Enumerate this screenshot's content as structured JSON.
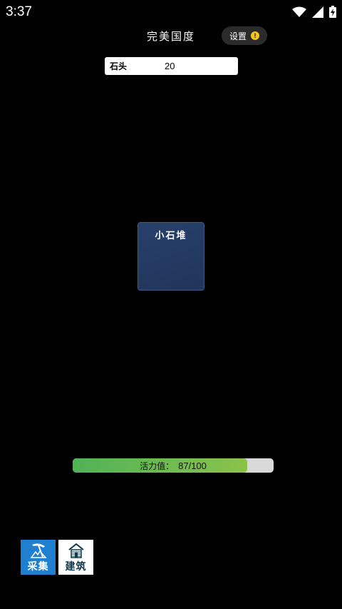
{
  "status_bar": {
    "time": "3:37"
  },
  "header": {
    "title": "完美国度",
    "settings_label": "设置",
    "settings_badge": "!"
  },
  "resources": [
    {
      "name": "石头",
      "value": "20"
    }
  ],
  "stone_pile": {
    "label": "小石堆"
  },
  "energy": {
    "label": "活力值：",
    "value_text": "87/100",
    "current": 87,
    "max": 100
  },
  "bottom_nav": {
    "gather_label": "采集",
    "build_label": "建筑"
  }
}
